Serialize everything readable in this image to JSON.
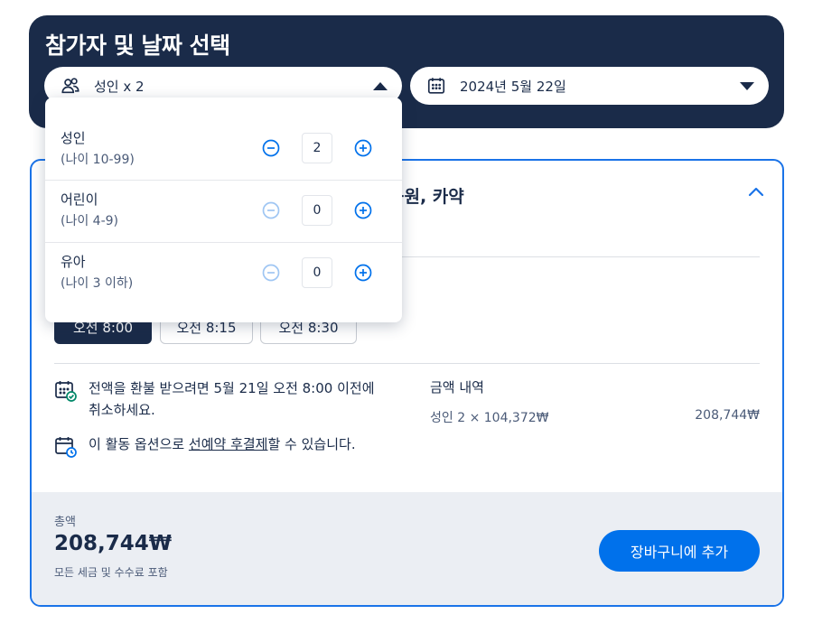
{
  "header": {
    "title": "참가자 및 날짜 선택",
    "participants_label": "성인 x 2",
    "date_label": "2024년 5월 22일"
  },
  "participants_dropdown": {
    "rows": [
      {
        "label": "성인",
        "age": "(나이 10-99)",
        "count": "2",
        "minus_enabled": true
      },
      {
        "label": "어린이",
        "age": "(나이 4-9)",
        "count": "0",
        "minus_enabled": false
      },
      {
        "label": "유아",
        "age": "(나이 3 이하)",
        "count": "0",
        "minus_enabled": false
      }
    ]
  },
  "option": {
    "title_partial": "공원, 카약",
    "times": [
      "오전 8:00",
      "오전 8:15",
      "오전 8:30"
    ],
    "selected_time_index": 0
  },
  "info": {
    "refund_text": "전액을 환불 받으려면 5월 21일 오전 8:00 이전에 취소하세요.",
    "reserve_prefix": "이 활동 옵션으로 ",
    "reserve_link": "선예약 후결제",
    "reserve_suffix": "할 수 있습니다."
  },
  "price": {
    "title": "금액 내역",
    "line": "성인 2 × 104,372₩",
    "line_amount": "208,744₩"
  },
  "footer": {
    "total_label": "총액",
    "total_amount": "208,744₩",
    "tax_note": "모든 세금 및 수수료 포함",
    "cart_button": "장바구니에 추가"
  },
  "colors": {
    "navy": "#1a2b49",
    "accent_blue": "#0071eb",
    "card_border": "#1a73e8",
    "footer_bg": "#ebeef3"
  },
  "icons": {
    "participants": "people-icon",
    "date": "calendar-icon",
    "refund": "calendar-check-icon",
    "reserve": "calendar-clock-icon",
    "collapse": "chevron-up-icon"
  }
}
